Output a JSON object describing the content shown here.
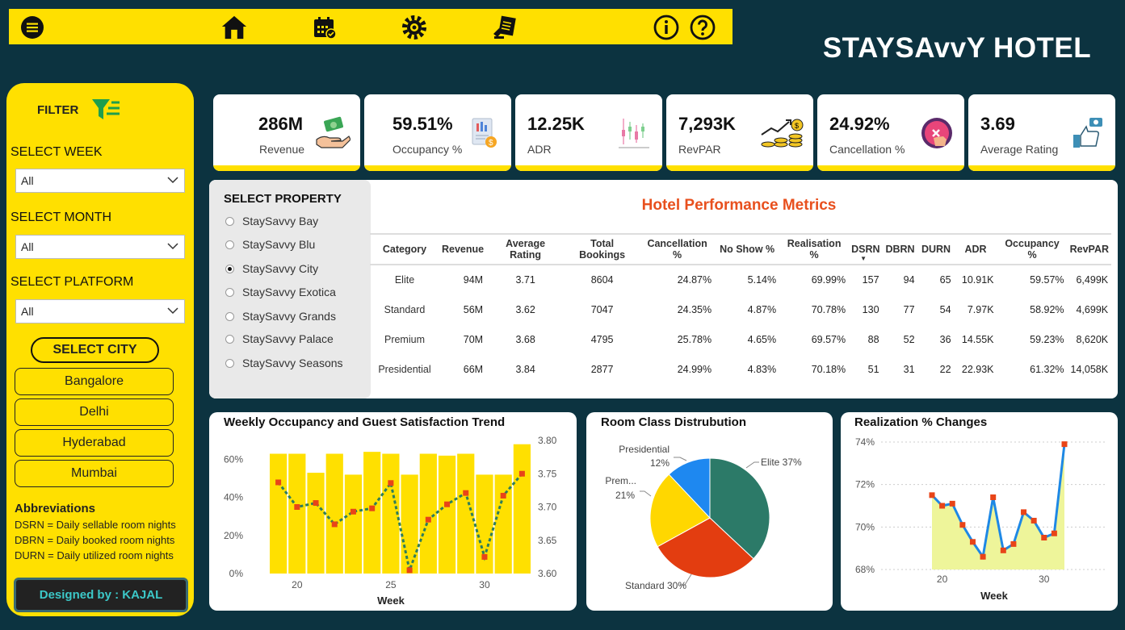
{
  "app_title": "STAYSAvvY HOTEL",
  "topbar": {
    "icons": [
      "menu-icon",
      "home-icon",
      "calendar-icon",
      "settings-icon",
      "report-icon",
      "info-icon",
      "help-icon"
    ]
  },
  "filter": {
    "title": "FILTER",
    "week": {
      "label": "SELECT WEEK",
      "value": "All"
    },
    "month": {
      "label": "SELECT MONTH",
      "value": "All"
    },
    "platform": {
      "label": "SELECT PLATFORM",
      "value": "All"
    },
    "city_header": "SELECT CITY",
    "cities": [
      "Bangalore",
      "Delhi",
      "Hyderabad",
      "Mumbai"
    ]
  },
  "abbreviations": {
    "title": "Abbreviations",
    "lines": [
      "DSRN = Daily sellable room nights",
      "DBRN = Daily booked room nights",
      "DURN = Daily utilized room nights"
    ]
  },
  "designed_by": "Designed by : KAJAL",
  "kpis": [
    {
      "value": "286M",
      "label": "Revenue",
      "icon": "money-hand-icon"
    },
    {
      "value": "59.51%",
      "label": "Occupancy %",
      "icon": "document-coin-icon"
    },
    {
      "value": "12.25K",
      "label": "ADR",
      "icon": "candlestick-icon"
    },
    {
      "value": "7,293K",
      "label": "RevPAR",
      "icon": "growth-coins-icon"
    },
    {
      "value": "24.92%",
      "label": "Cancellation %",
      "icon": "cancel-hand-icon"
    },
    {
      "value": "3.69",
      "label": "Average Rating",
      "icon": "thumbs-up-rating-icon"
    }
  ],
  "property": {
    "title": "SELECT PROPERTY",
    "options": [
      "StaySavvy Bay",
      "StaySavvy Blu",
      "StaySavvy City",
      "StaySavvy Exotica",
      "StaySavvy Grands",
      "StaySavvy Palace",
      "StaySavvy Seasons"
    ],
    "selected": "StaySavvy City"
  },
  "table": {
    "title": "Hotel Performance Metrics",
    "columns": [
      "Category",
      "Revenue",
      "Average Rating",
      "Total Bookings",
      "Cancellation %",
      "No Show %",
      "Realisation %",
      "DSRN",
      "DBRN",
      "DURN",
      "ADR",
      "Occupancy %",
      "RevPAR"
    ],
    "rows": [
      [
        "Elite",
        "94M",
        "3.71",
        "8604",
        "24.87%",
        "5.14%",
        "69.99%",
        "157",
        "94",
        "65",
        "10.91K",
        "59.57%",
        "6,499K"
      ],
      [
        "Standard",
        "56M",
        "3.62",
        "7047",
        "24.35%",
        "4.87%",
        "70.78%",
        "130",
        "77",
        "54",
        "7.97K",
        "58.92%",
        "4,699K"
      ],
      [
        "Premium",
        "70M",
        "3.68",
        "4795",
        "25.78%",
        "4.65%",
        "69.57%",
        "88",
        "52",
        "36",
        "14.55K",
        "59.23%",
        "8,620K"
      ],
      [
        "Presidential",
        "66M",
        "3.84",
        "2877",
        "24.99%",
        "4.83%",
        "70.18%",
        "51",
        "31",
        "22",
        "22.93K",
        "61.32%",
        "14,058K"
      ]
    ]
  },
  "chart_data": [
    {
      "type": "bar",
      "title": "Weekly Occupancy and Guest Satisfaction Trend",
      "xlabel": "Week",
      "x": [
        19,
        20,
        21,
        22,
        23,
        24,
        25,
        26,
        27,
        28,
        29,
        30,
        31,
        32
      ],
      "x_ticks": [
        "20",
        "25",
        "30"
      ],
      "series": [
        {
          "axis": "left",
          "kind": "bar",
          "values": [
            63,
            63,
            53,
            63,
            52,
            64,
            63,
            52,
            63,
            62,
            63,
            52,
            52,
            68
          ]
        },
        {
          "axis": "right",
          "kind": "line",
          "values": [
            3.737,
            3.7,
            3.706,
            3.674,
            3.693,
            3.698,
            3.736,
            3.605,
            3.681,
            3.704,
            3.721,
            3.625,
            3.717,
            3.75
          ]
        }
      ],
      "y_left": {
        "ticks": [
          "0%",
          "20%",
          "40%",
          "60%"
        ],
        "range": [
          0,
          70
        ]
      },
      "y_right": {
        "ticks": [
          "3.60",
          "3.65",
          "3.70",
          "3.75",
          "3.80"
        ],
        "range": [
          3.6,
          3.8
        ]
      },
      "colors": {
        "bar": "#ffe000",
        "line": "#2e7d5b",
        "marker": "#e84418"
      }
    },
    {
      "type": "pie",
      "title": "Room Class Distrubution",
      "slices": [
        {
          "label": "Elite",
          "percent": 37,
          "display": "Elite 37%",
          "color": "#2c7a68"
        },
        {
          "label": "Standard",
          "percent": 30,
          "display": "Standard 30%",
          "color": "#e33d10"
        },
        {
          "label": "Premium",
          "percent": 21,
          "display": "Prem...",
          "display2": "21%",
          "color": "#ffd700"
        },
        {
          "label": "Presidential",
          "percent": 12,
          "display": "Presidential",
          "display2": "12%",
          "color": "#1e88f0"
        }
      ]
    },
    {
      "type": "area",
      "title": "Realization % Changes",
      "xlabel": "Week",
      "x": [
        19,
        20,
        21,
        22,
        23,
        24,
        25,
        26,
        27,
        28,
        29,
        30,
        31,
        32
      ],
      "x_ticks": [
        "20",
        "30"
      ],
      "values": [
        71.5,
        71.0,
        71.1,
        70.1,
        69.3,
        68.6,
        71.4,
        68.9,
        69.2,
        70.7,
        70.3,
        69.5,
        69.7,
        73.9
      ],
      "y_ticks": [
        "68%",
        "70%",
        "72%",
        "74%"
      ],
      "ylim": [
        68,
        74
      ],
      "colors": {
        "area": "#eef59a",
        "line": "#1e88e5",
        "marker": "#e84418"
      }
    }
  ]
}
